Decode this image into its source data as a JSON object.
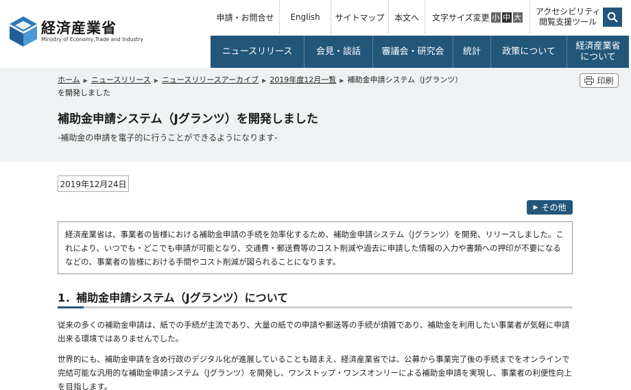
{
  "header": {
    "logo_jp": "経済産業省",
    "logo_en": "Ministry of Economy,Trade and Industry",
    "util": {
      "apply_contact": "申請・お問合せ",
      "english": "English",
      "sitemap": "サイトマップ",
      "main_text": "本文へ",
      "font_size_label": "文字サイズ変更",
      "size_small": "小",
      "size_medium": "中",
      "size_large": "大",
      "access_line1": "アクセシビリティ",
      "access_line2": "閲覧支援ツール"
    },
    "nav": [
      {
        "label": "ニュースリリース"
      },
      {
        "label": "会見・談話"
      },
      {
        "label": "審議会・研究会"
      },
      {
        "label": "統計"
      },
      {
        "label": "政策について"
      },
      {
        "label": "経済産業省",
        "label2": "について"
      }
    ]
  },
  "breadcrumb": {
    "items": [
      "ホーム",
      "ニュースリリース",
      "ニュースリリースアーカイブ",
      "2019年度12月一覧"
    ],
    "current": "補助金申請システム（Jグランツ）を開発しました"
  },
  "print_label": "印刷",
  "title": "補助金申請システム（Jグランツ）を開発しました",
  "subtitle": "-補助金の申請を電子的に行うことができるようになります-",
  "date": "2019年12月24日",
  "other_label": "その他",
  "summary": "経済産業省は、事業者の皆様における補助金申請の手続を効率化するため、補助金申請システム（Jグランツ）を開発、リリースしました。これにより、いつでも・どこでも申請が可能となり、交通費・郵送費等のコスト削減や過去に申請した情報の入力や書類への押印が不要になるなどの、事業者の皆様における手間やコスト削減が図られることになります。",
  "section1": {
    "heading": "1．補助金申請システム（Jグランツ）について",
    "p1": "従来の多くの補助金申請は、紙での手続が主流であり、大量の紙での申請や郵送等の手続が煩雑であり、補助金を利用したい事業者が気軽に申請出来る環境ではありませんでした。",
    "p2": "世界的にも、補助金申請を含め行政のデジタル化が進展していることも踏まえ、経済産業省では、公募から事業完了後の手続までをオンラインで完結可能な汎用的な補助金申請システム（Jグランツ）を開発し、ワンストップ・ワンスオンリーによる補助金申請を実現し、事業者の利便性向上を目指します。"
  }
}
